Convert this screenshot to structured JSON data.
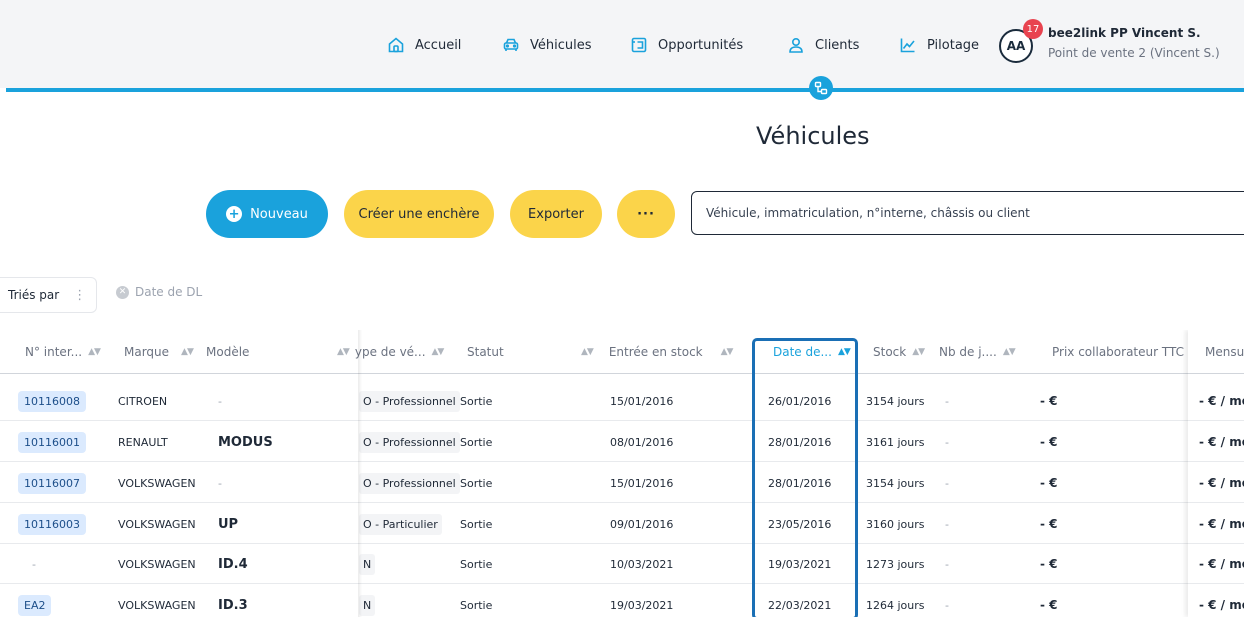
{
  "nav": {
    "items": [
      {
        "label": "Accueil",
        "icon": "home-icon"
      },
      {
        "label": "Véhicules",
        "icon": "car-icon"
      },
      {
        "label": "Opportunités",
        "icon": "opportunity-icon"
      },
      {
        "label": "Clients",
        "icon": "user-icon"
      },
      {
        "label": "Pilotage",
        "icon": "chart-line-icon"
      }
    ],
    "avatar_initials": "AA",
    "notification_count": "17",
    "user_name": "bee2link PP Vincent S.",
    "store_name": "Point de vente 2 (Vincent S.)"
  },
  "page": {
    "title": "Véhicules"
  },
  "toolbar": {
    "new_label": "Nouveau",
    "auction_label": "Créer une enchère",
    "export_label": "Exporter",
    "more_label": "···",
    "search_placeholder": "Véhicule, immatriculation, n°interne, châssis ou client"
  },
  "sorting": {
    "label": "Triés par",
    "chip": "Date de DL"
  },
  "table": {
    "columns": [
      "N° inter...",
      "Marque",
      "Modèle",
      "ype de vé...",
      "Statut",
      "Entrée en stock",
      "Date de...",
      "Stock",
      "Nb de j....",
      "Prix collaborateur TTC",
      "Mensu"
    ],
    "active_sort_column": "Date de...",
    "rows": [
      {
        "id": "10116008",
        "brand": "CITROEN",
        "model": "-",
        "type": "O - Professionnel",
        "status": "Sortie",
        "entry": "15/01/2016",
        "date": "26/01/2016",
        "stock": "3154 jours",
        "days": "-",
        "price": "- €",
        "monthly": "- € / mo"
      },
      {
        "id": "10116001",
        "brand": "RENAULT",
        "model": "MODUS",
        "type": "O - Professionnel",
        "status": "Sortie",
        "entry": "08/01/2016",
        "date": "28/01/2016",
        "stock": "3161 jours",
        "days": "-",
        "price": "- €",
        "monthly": "- € / mo"
      },
      {
        "id": "10116007",
        "brand": "VOLKSWAGEN",
        "model": "-",
        "type": "O - Professionnel",
        "status": "Sortie",
        "entry": "15/01/2016",
        "date": "28/01/2016",
        "stock": "3154 jours",
        "days": "-",
        "price": "- €",
        "monthly": "- € / mo"
      },
      {
        "id": "10116003",
        "brand": "VOLKSWAGEN",
        "model": "UP",
        "type": "O - Particulier",
        "status": "Sortie",
        "entry": "09/01/2016",
        "date": "23/05/2016",
        "stock": "3160 jours",
        "days": "-",
        "price": "- €",
        "monthly": "- € / mo"
      },
      {
        "id": "-",
        "brand": "VOLKSWAGEN",
        "model": "ID.4",
        "type": "N",
        "status": "Sortie",
        "entry": "10/03/2021",
        "date": "19/03/2021",
        "stock": "1273 jours",
        "days": "-",
        "price": "- €",
        "monthly": "- € / mo"
      },
      {
        "id": "EA2",
        "brand": "VOLKSWAGEN",
        "model": "ID.3",
        "type": "N",
        "status": "Sortie",
        "entry": "19/03/2021",
        "date": "22/03/2021",
        "stock": "1264 jours",
        "days": "-",
        "price": "- €",
        "monthly": "- € / mo"
      }
    ]
  },
  "colors": {
    "accent": "#1aa2dc",
    "button_yellow": "#fbd44a",
    "highlight_border": "#1a6fb5",
    "notification": "#e8434f"
  }
}
